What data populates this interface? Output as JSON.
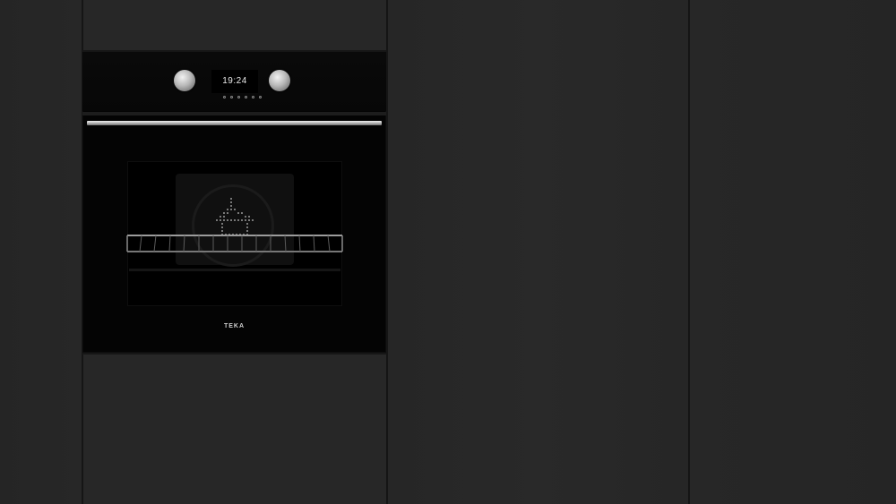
{
  "scene": {
    "description_colors": {
      "cabinet": "#262626",
      "seam": "#151515",
      "oven_glass": "#040404",
      "steel": "#c8c8c8"
    }
  },
  "oven": {
    "display_time": "19:24",
    "brand": "TEKA",
    "indicator_count": 6
  }
}
